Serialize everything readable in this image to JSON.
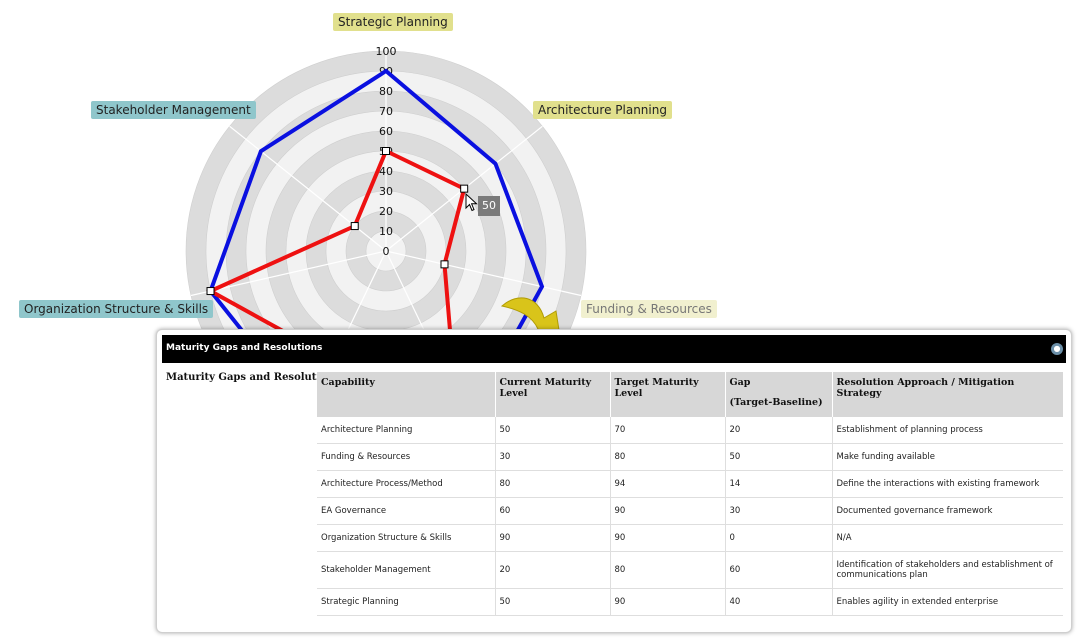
{
  "radar": {
    "axes": [
      "Strategic Planning",
      "Architecture Planning",
      "Funding & Resources",
      "Architecture Process/Method",
      "EA Governance",
      "Organization Structure & Skills",
      "Stakeholder Management"
    ],
    "visible_axis_labels": {
      "strategic": "Strategic Planning",
      "architecture_planning": "Architecture Planning",
      "funding": "Funding & Resources",
      "org_structure": "Organization Structure & Skills",
      "stakeholder": "Stakeholder Management"
    },
    "ticks": [
      "100",
      "90",
      "80",
      "70",
      "60",
      "50",
      "40",
      "30",
      "20",
      "10",
      "0"
    ],
    "max": 100,
    "series": [
      {
        "key": "target",
        "color": "#0a10e0",
        "values": [
          90,
          70,
          80,
          94,
          90,
          90,
          80
        ]
      },
      {
        "key": "current",
        "color": "#ee1111",
        "values": [
          50,
          50,
          30,
          80,
          60,
          90,
          20
        ]
      }
    ],
    "tooltip": "50"
  },
  "panel": {
    "title": "Maturity Gaps and Resolutions",
    "info_icon": "info-icon",
    "side_label": "Maturity Gaps and Resolutions"
  },
  "table": {
    "headers": {
      "capability": "Capability",
      "current": "Current Maturity Level",
      "target": "Target Maturity Level",
      "gap": "Gap",
      "gap_sub": "(Target-Baseline)",
      "resolution": "Resolution Approach / Mitigation Strategy"
    },
    "rows": [
      {
        "capability": "Architecture Planning",
        "current": "50",
        "target": "70",
        "gap": "20",
        "resolution": "Establishment of planning process"
      },
      {
        "capability": "Funding & Resources",
        "current": "30",
        "target": "80",
        "gap": "50",
        "resolution": "Make funding available"
      },
      {
        "capability": "Architecture Process/Method",
        "current": "80",
        "target": "94",
        "gap": "14",
        "resolution": "Define the interactions with existing framework"
      },
      {
        "capability": "EA Governance",
        "current": "60",
        "target": "90",
        "gap": "30",
        "resolution": "Documented governance framework"
      },
      {
        "capability": "Organization Structure & Skills",
        "current": "90",
        "target": "90",
        "gap": "0",
        "resolution": "N/A"
      },
      {
        "capability": "Stakeholder Management",
        "current": "20",
        "target": "80",
        "gap": "60",
        "resolution": "Identification of stakeholders and establishment of communications plan"
      },
      {
        "capability": "Strategic Planning",
        "current": "50",
        "target": "90",
        "gap": "40",
        "resolution": "Enables agility in extended enterprise"
      }
    ]
  }
}
